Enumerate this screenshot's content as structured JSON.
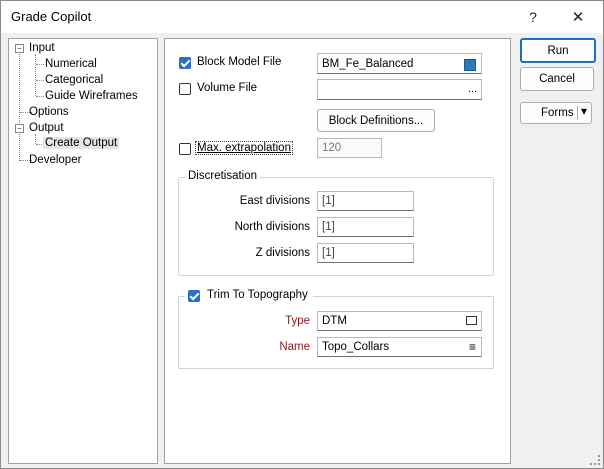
{
  "window": {
    "title": "Grade Copilot",
    "help_glyph": "?",
    "close_glyph": "✕"
  },
  "tree": {
    "input": "Input",
    "numerical": "Numerical",
    "categorical": "Categorical",
    "guide_wireframes": "Guide Wireframes",
    "options": "Options",
    "output": "Output",
    "create_output": "Create Output",
    "developer": "Developer"
  },
  "form": {
    "block_model_label": "Block Model File",
    "block_model_value": "BM_Fe_Balanced",
    "block_model_checked": true,
    "volume_label": "Volume File",
    "volume_value": "",
    "volume_checked": false,
    "block_definitions_button": "Block Definitions...",
    "max_extrapolation_label": "Max. extrapolation",
    "max_extrapolation_value": "120",
    "discretisation": {
      "legend": "Discretisation",
      "east_label": "East divisions",
      "east_value": "[1]",
      "north_label": "North divisions",
      "north_value": "[1]",
      "z_label": "Z divisions",
      "z_value": "[1]"
    },
    "topography": {
      "legend": "Trim To Topography",
      "checked": true,
      "type_label": "Type",
      "type_value": "DTM",
      "name_label": "Name",
      "name_value": "Topo_Collars"
    }
  },
  "buttons": {
    "run": "Run",
    "cancel": "Cancel",
    "forms": "Forms"
  },
  "icons": {
    "ellipsis": "...",
    "list": "≡",
    "dropdown": "▾"
  }
}
